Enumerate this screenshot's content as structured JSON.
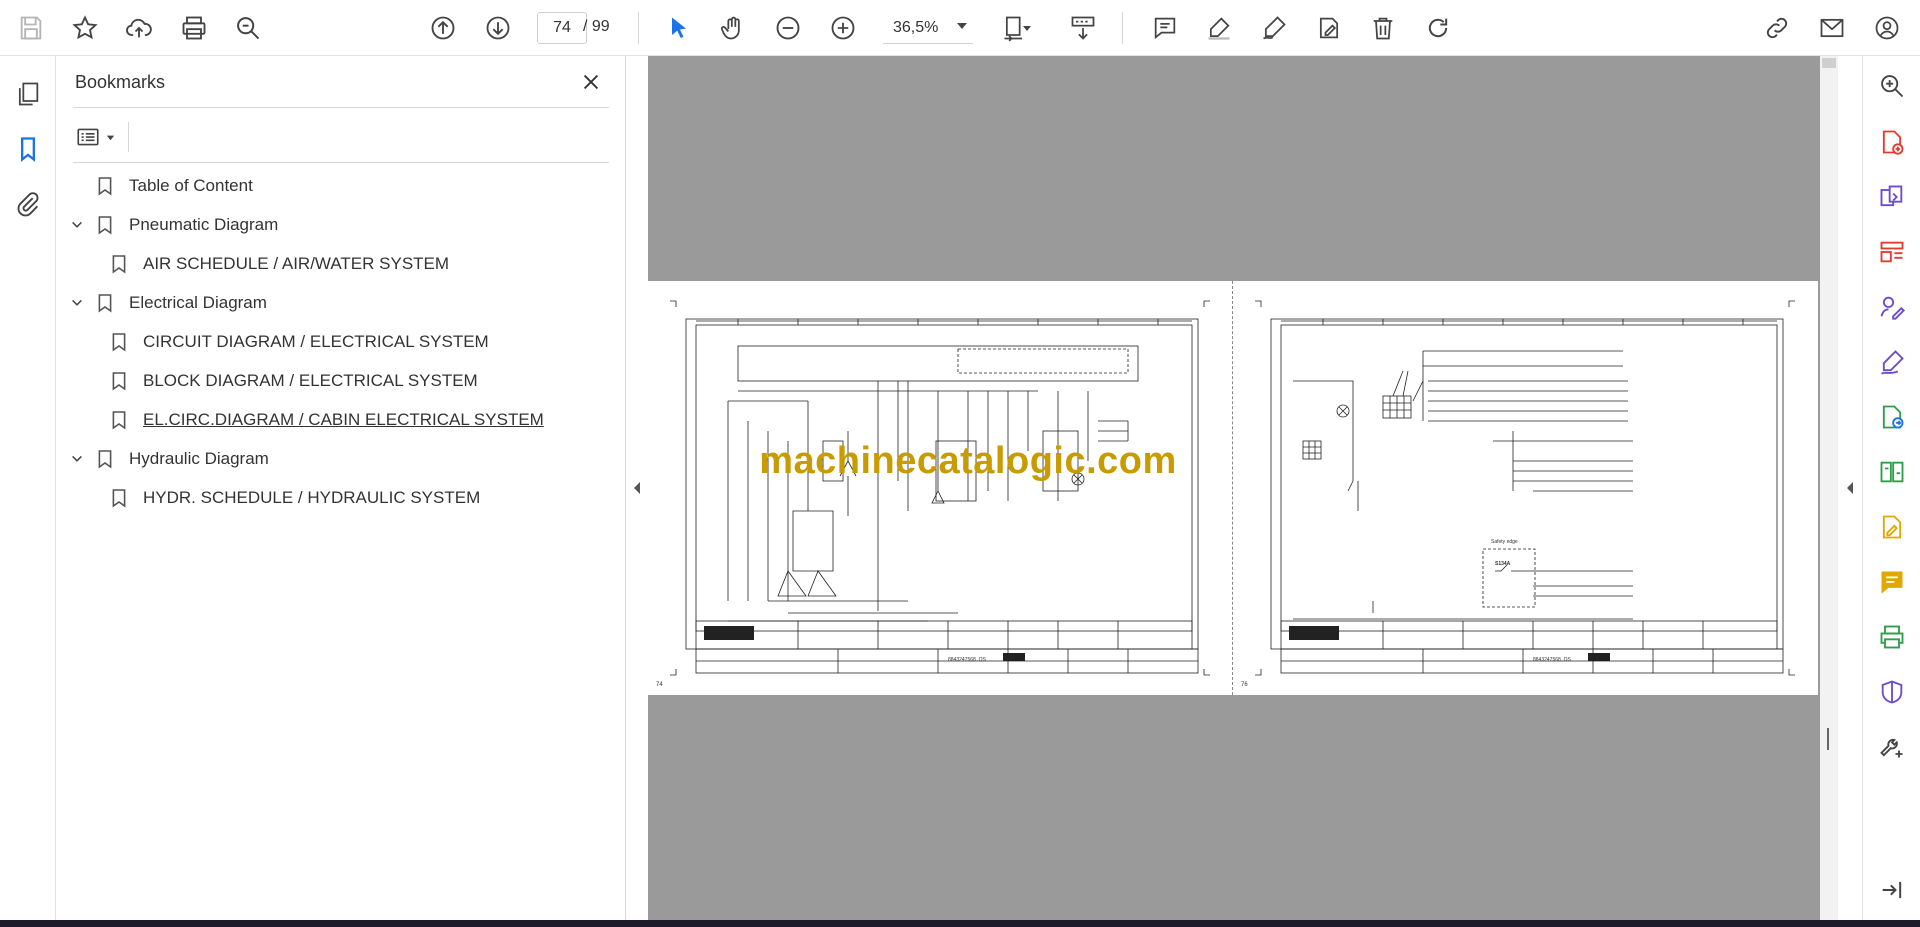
{
  "toolbar": {
    "current_page": "74",
    "page_total": "/ 99",
    "zoom_level": "36,5%"
  },
  "bookmarks": {
    "title": "Bookmarks",
    "items": [
      {
        "label": "Table of Content",
        "level": 0,
        "expandable": false
      },
      {
        "label": "Pneumatic Diagram",
        "level": 0,
        "expandable": true
      },
      {
        "label": "AIR SCHEDULE / AIR/WATER SYSTEM",
        "level": 1,
        "expandable": false
      },
      {
        "label": "Electrical Diagram",
        "level": 0,
        "expandable": true
      },
      {
        "label": "CIRCUIT DIAGRAM / ELECTRICAL SYSTEM",
        "level": 1,
        "expandable": false
      },
      {
        "label": "BLOCK DIAGRAM / ELECTRICAL SYSTEM",
        "level": 1,
        "expandable": false
      },
      {
        "label": "EL.CIRC.DIAGRAM / CABIN ELECTRICAL SYSTEM",
        "level": 1,
        "expandable": false,
        "active": true
      },
      {
        "label": "Hydraulic Diagram",
        "level": 0,
        "expandable": true
      },
      {
        "label": "HYDR. SCHEDULE / HYDRAULIC SYSTEM",
        "level": 1,
        "expandable": false
      }
    ]
  },
  "document": {
    "watermark": "machinecatalogic.com",
    "left_page_number": "74",
    "right_page_number": "76",
    "left_doc_code": "8843247568 .OS",
    "right_doc_code": "8843247568 .OS",
    "right_safety_label": "Safety edge",
    "right_component": "S134A"
  },
  "colors": {
    "accent_blue": "#1a73e8",
    "pdf_red": "#e03c31",
    "tools_purple": "#6c4bd1",
    "tools_yellow": "#e0a800",
    "tools_green": "#2e9e49",
    "watermark_gold": "#c89b00"
  },
  "icons": {
    "toolbar": [
      "save-icon",
      "star-icon",
      "cloud-upload-icon",
      "print-icon",
      "search-icon",
      "page-up-icon",
      "page-down-icon",
      "pointer-icon",
      "hand-icon",
      "zoom-out-icon",
      "zoom-in-icon",
      "page-fit-icon",
      "scroll-mode-icon",
      "comment-icon",
      "highlight-icon",
      "draw-icon",
      "edit-text-icon",
      "trash-icon",
      "redo-icon",
      "link-icon",
      "mail-icon",
      "account-icon"
    ],
    "left_rail": [
      "page-thumbnails-icon",
      "bookmark-icon",
      "attachment-icon"
    ],
    "right_rail": [
      "zoom-search-icon",
      "create-pdf-icon",
      "combine-files-icon",
      "organize-pages-icon",
      "request-signature-icon",
      "fill-sign-icon",
      "export-pdf-icon",
      "compare-files-icon",
      "edit-pdf-icon",
      "comment-tool-icon",
      "scan-ocr-icon",
      "protect-icon",
      "more-tools-icon",
      "expand-panel-icon"
    ]
  }
}
